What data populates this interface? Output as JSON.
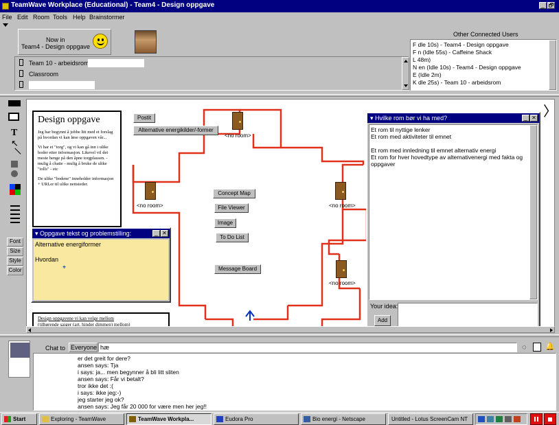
{
  "window": {
    "title": "TeamWave Workplace (Educational) - Team4 - Design oppgave",
    "controls": [
      "_",
      "🗗"
    ]
  },
  "menu": [
    "File",
    "Edit",
    "Room",
    "Tools",
    "Help",
    "Brainstormer"
  ],
  "now_in": {
    "line1": "Now in",
    "line2": "Team4 - Design oppgave"
  },
  "rooms": [
    "Team 10 - arbeidsrom",
    "Classroom",
    ""
  ],
  "users": {
    "header": "Other Connected Users",
    "items": [
      "F           dle 10s) - Team4 - Design oppgave",
      "F           n (Idle 55s) - Caffeine Shack",
      "L           48m)",
      "N           en (Idle 10s) - Team4 - Design oppgave",
      "E           (Idle 2m)",
      "K           dle 25s) - Team 10 - arbeidsrom"
    ]
  },
  "side_tools": [
    "Font",
    "Size",
    "Style",
    "Color"
  ],
  "doc": {
    "title": "Design oppgave",
    "p1": "Jeg har begynnt å jobbe litt med et forslag på hvordan vi kan løse oppgaven vår...",
    "p2": "Vi har et \"torg\", og vi kan gå inn i ulike boder etter informasjon. Likevel vil det meste henge på den åpne torgplassen. - mulig å chatte - mulig å bruke de ulike \"tolls\" - etc",
    "p3": "De ulike \"bodene\" inneholder informasjon + URLer til ulike nettsteder.",
    "foot1": "Design oppgavene vi kan velge mellom",
    "foot2": "(tilhørende saiger (art. hinder dimmen) mellom)"
  },
  "board": {
    "postit": "Postit",
    "alt": "Alternative energikilder/-former",
    "concept": "Concept Map",
    "fileviewer": "File Viewer",
    "image": "Image",
    "todo": "To Do List",
    "message": "Message Board",
    "noroom": "<no room>"
  },
  "oppgave": {
    "title": "Oppgave tekst og problemstilling:",
    "lines": [
      "Alternative energiformer",
      "",
      "Hvordan"
    ]
  },
  "hvilke": {
    "title": "Hvilke rom bør vi ha med?",
    "lines": [
      "Et rom til nyttige lenker",
      "Et rom med aktiviteter til emnet",
      "",
      "Et rom med innledning til emnet alternativ energi",
      "Et rom for hver hovedtype av alternativenergi med fakta og oppgaver"
    ],
    "idea_label": "Your idea:",
    "add": "Add"
  },
  "chat": {
    "label": "Chat to",
    "target": "Everyone",
    "input": "hæ",
    "log": [
      "er det greit for dere?",
      "ansen says: Tja",
      "i says: ja... men begynner å bli litt sliten",
      "ansen says: Får vi betalt?",
      "tror ikke det :(",
      "i says: ikke jeg:-)",
      "jeg starter jeg ok?",
      "ansen says: Jeg får 20 000 for være men her jeg!!"
    ]
  },
  "taskbar": {
    "start": "Start",
    "tasks": [
      "Exploring - TeamWave",
      "TeamWave Workpla...",
      "Eudora Pro",
      "Bio energi - Netscape",
      "Untitled - Lotus ScreenCam NT"
    ]
  },
  "colors": {
    "titlebar": "#000080",
    "wire": "#e0301a",
    "note": "#f8e8a0",
    "desktop": "#c0c0c0"
  }
}
